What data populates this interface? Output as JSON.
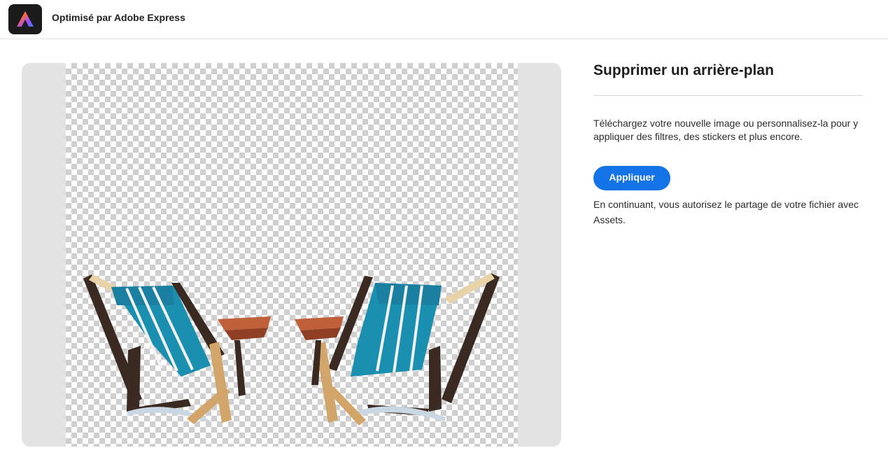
{
  "header": {
    "logo_icon": "adobe-express-logo-icon",
    "brand_text": "Optimisé par Adobe Express"
  },
  "preview": {
    "image_subject": "two-beach-chairs-with-side-tables",
    "background": "transparent-checkerboard"
  },
  "panel": {
    "title": "Supprimer un arrière-plan",
    "description": "Téléchargez votre nouvelle image ou personnalisez-la pour y appliquer des filtres, des stickers et plus encore.",
    "apply_label": "Appliquer",
    "consent_text": "En continuant, vous autorisez le partage de votre fichier avec Assets."
  },
  "colors": {
    "accent": "#1473e6",
    "logo_bg": "#1b1b1b"
  }
}
